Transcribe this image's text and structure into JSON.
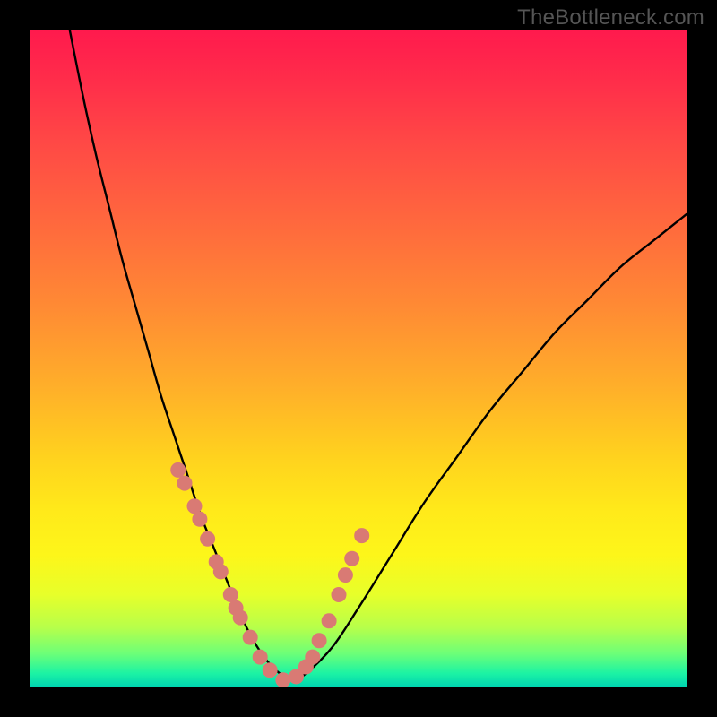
{
  "attribution": "TheBottleneck.com",
  "chart_data": {
    "type": "line",
    "title": "",
    "xlabel": "",
    "ylabel": "",
    "xlim": [
      0,
      100
    ],
    "ylim": [
      0,
      100
    ],
    "grid": false,
    "legend": false,
    "series": [
      {
        "name": "bottleneck-curve",
        "x": [
          6,
          8,
          10,
          12,
          14,
          16,
          18,
          20,
          22,
          24,
          26,
          28,
          30,
          32,
          34,
          36,
          38,
          40,
          42,
          46,
          50,
          55,
          60,
          65,
          70,
          75,
          80,
          85,
          90,
          95,
          100
        ],
        "y": [
          100,
          90,
          81,
          73,
          65,
          58,
          51,
          44,
          38,
          32,
          26,
          21,
          16,
          11,
          7,
          4,
          2,
          1,
          2,
          6,
          12,
          20,
          28,
          35,
          42,
          48,
          54,
          59,
          64,
          68,
          72
        ]
      }
    ],
    "highlight_points": {
      "name": "marked-points",
      "x": [
        22.5,
        23.5,
        25.0,
        25.8,
        27.0,
        28.3,
        29.0,
        30.5,
        31.3,
        32.0,
        33.5,
        35.0,
        36.5,
        38.5,
        40.5,
        42.0,
        43.0,
        44.0,
        45.5,
        47.0,
        48.0,
        49.0,
        50.5
      ],
      "y": [
        33,
        31,
        27.5,
        25.5,
        22.5,
        19,
        17.5,
        14,
        12,
        10.5,
        7.5,
        4.5,
        2.5,
        1,
        1.5,
        3,
        4.5,
        7,
        10,
        14,
        17,
        19.5,
        23
      ]
    },
    "background_gradient": {
      "top": "#ff1a4d",
      "mid": "#ffd21e",
      "bottom": "#00d5b0"
    }
  }
}
